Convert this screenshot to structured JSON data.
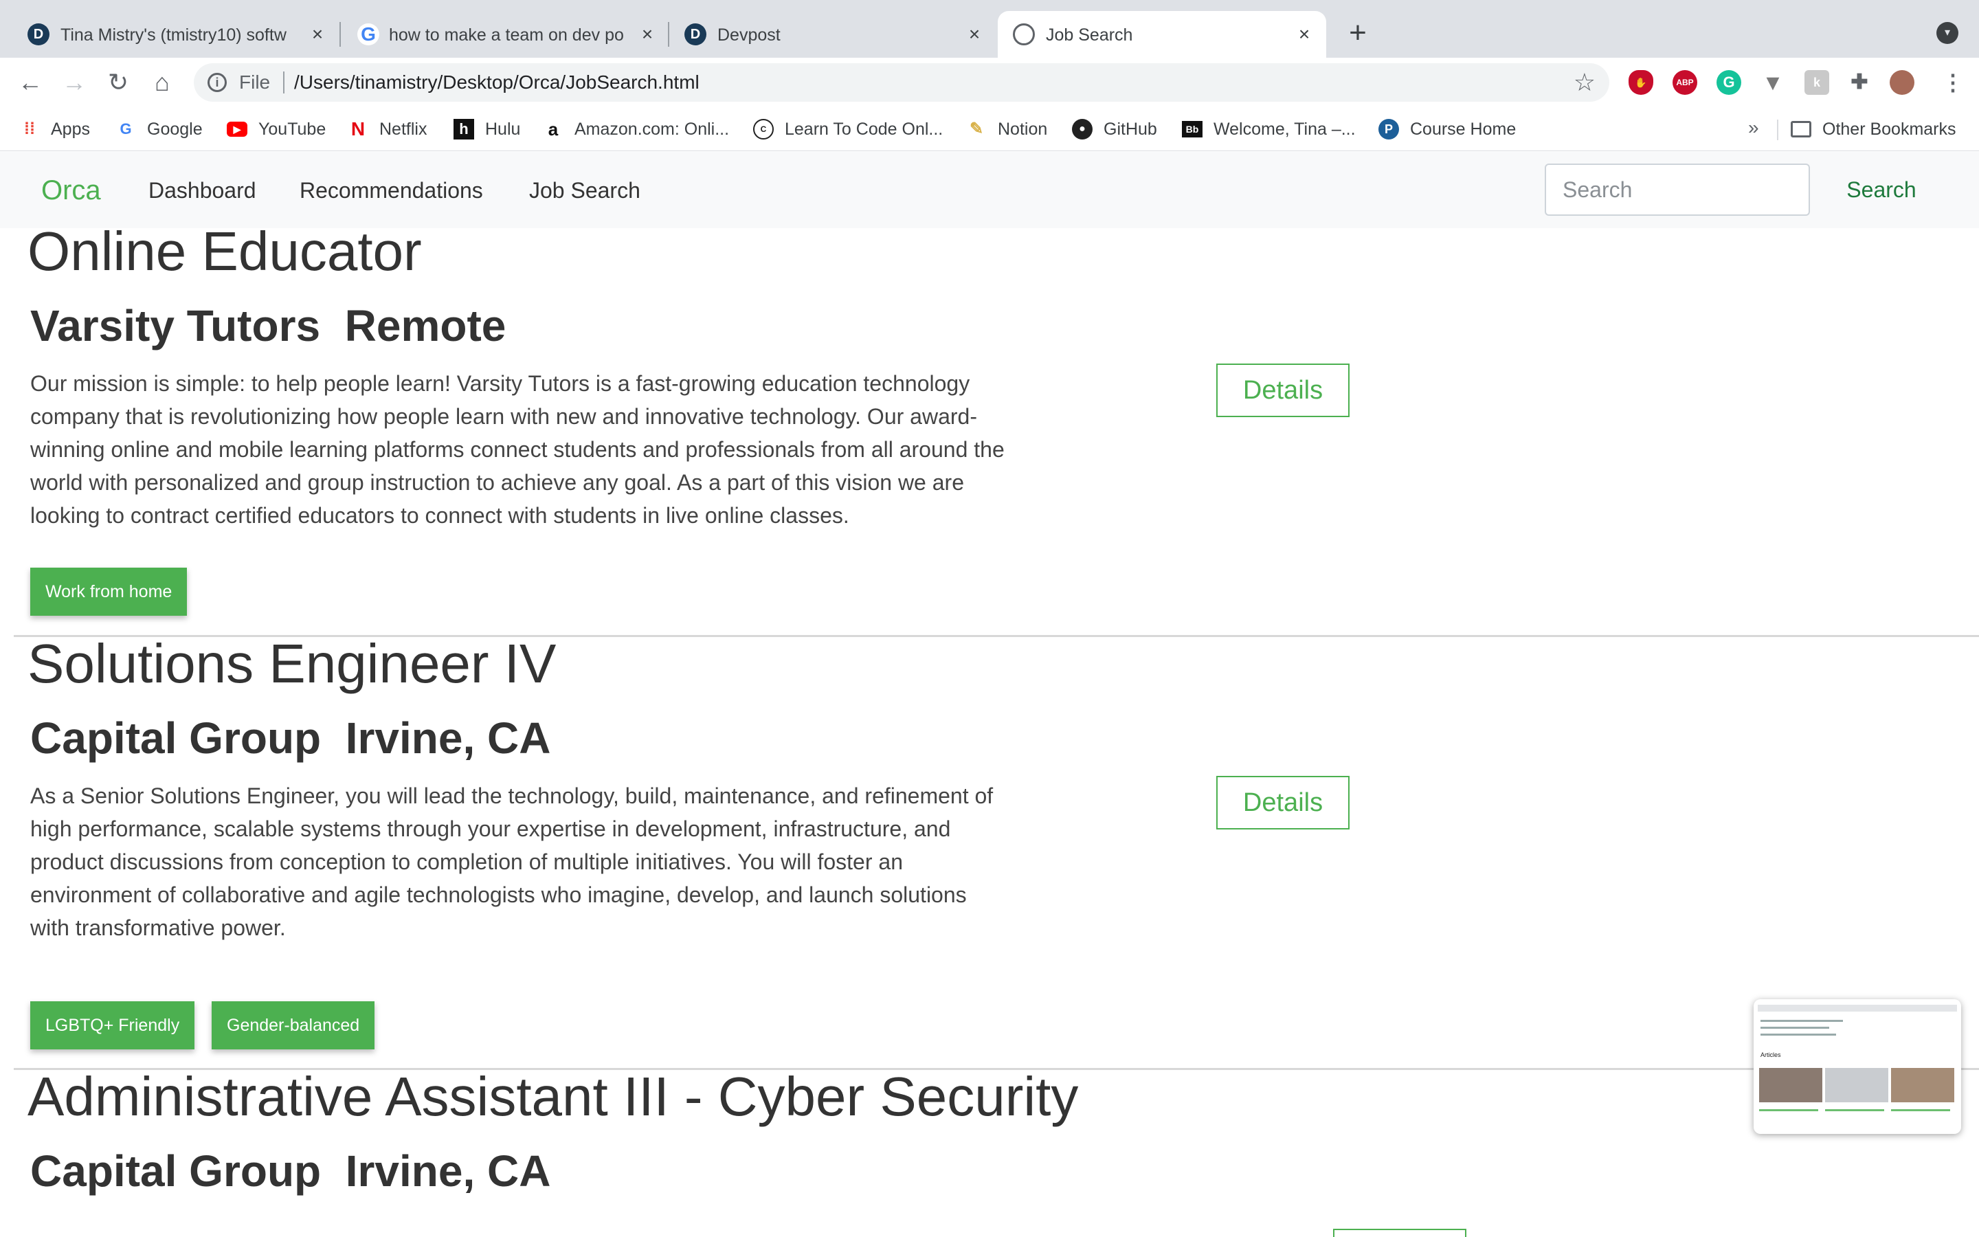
{
  "browser": {
    "tabs": [
      {
        "title": "Tina Mistry's (tmistry10) softw",
        "favicon": "devpost-icon",
        "active": false
      },
      {
        "title": "how to make a team on dev po",
        "favicon": "google-icon",
        "active": false
      },
      {
        "title": "Devpost",
        "favicon": "devpost-icon",
        "active": false
      },
      {
        "title": "Job Search",
        "favicon": "globe-icon",
        "active": true
      }
    ],
    "omnibox": {
      "scheme": "File",
      "url": "/Users/tinamistry/Desktop/Orca/JobSearch.html"
    },
    "bookmarks": [
      {
        "label": "Apps",
        "icon": "apps-grid-icon"
      },
      {
        "label": "Google",
        "icon": "google-icon"
      },
      {
        "label": "YouTube",
        "icon": "youtube-icon"
      },
      {
        "label": "Netflix",
        "icon": "netflix-icon"
      },
      {
        "label": "Hulu",
        "icon": "hulu-icon"
      },
      {
        "label": "Amazon.com: Onli...",
        "icon": "amazon-icon"
      },
      {
        "label": "Learn To Code Onl...",
        "icon": "codecademy-icon"
      },
      {
        "label": "Notion",
        "icon": "notion-icon"
      },
      {
        "label": "GitHub",
        "icon": "github-icon"
      },
      {
        "label": "Welcome, Tina –...",
        "icon": "blackboard-icon"
      },
      {
        "label": "Course Home",
        "icon": "pearson-icon"
      }
    ],
    "overflow_label": "»",
    "other_bookmarks": "Other Bookmarks"
  },
  "navbar": {
    "brand": "Orca",
    "links": [
      "Dashboard",
      "Recommendations",
      "Job Search"
    ],
    "search_placeholder": "Search",
    "search_button": "Search"
  },
  "jobs": [
    {
      "title": "Online Educator",
      "company": "Varsity Tutors  Remote",
      "description": "Our mission is simple: to help people learn! Varsity Tutors is a fast-growing education technology company that is revolutionizing how people learn with new and innovative technology. Our award-winning online and mobile learning platforms connect students and professionals from all around the world with personalized and group instruction to achieve any goal. As a part of this vision we are looking to contract certified educators to connect with students in live online classes.",
      "details_label": "Details",
      "tags": [
        "Work from home"
      ]
    },
    {
      "title": "Solutions Engineer IV",
      "company": "Capital Group  Irvine, CA",
      "description": "As a Senior Solutions Engineer, you will lead the technology, build, maintenance, and refinement of high performance, scalable systems through your expertise in development, infrastructure, and product discussions from conception to completion of multiple initiatives. You will foster an environment of collaborative and agile technologists who imagine, develop, and launch solutions with transformative power.",
      "details_label": "Details",
      "tags": [
        "LGBTQ+ Friendly",
        "Gender-balanced"
      ]
    },
    {
      "title": "Administrative Assistant III - Cyber Security",
      "company": "Capital Group  Irvine, CA",
      "description": "",
      "details_label": "",
      "tags": []
    }
  ],
  "thumbnail": {
    "heading": "Articles"
  },
  "colors": {
    "accent": "#4cb050",
    "navbar_bg": "#f8f9fa",
    "tabstrip_bg": "#dee1e6"
  }
}
